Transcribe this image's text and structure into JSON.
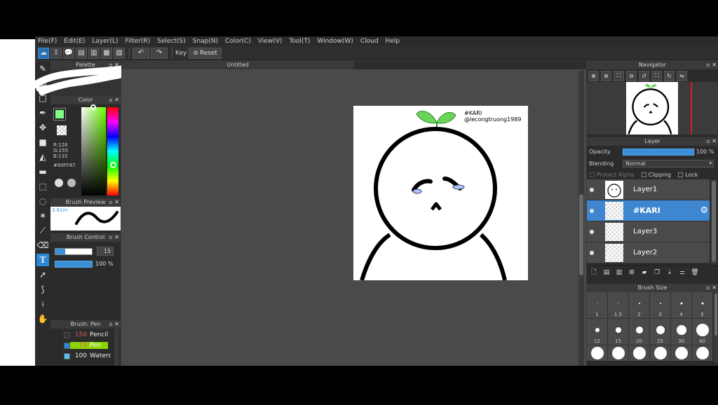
{
  "menu": [
    "File(F)",
    "Edit(E)",
    "Layer(L)",
    "Filter(R)",
    "Select(S)",
    "Snap(N)",
    "Color(C)",
    "View(V)",
    "Tool(T)",
    "Window(W)",
    "Cloud",
    "Help"
  ],
  "toolbar": {
    "key_label": "Key",
    "reset_label": "Reset"
  },
  "left": {
    "palette_title": "Palette",
    "color_title": "Color",
    "color_r": "R:128",
    "color_g": "G:255",
    "color_b": "B:135",
    "color_hex": "#80FF87",
    "primary_color": "#80FF87",
    "brush_preview_title": "Brush Preview",
    "brush_preview_size": "3.81m",
    "brush_control_title": "Brush Control",
    "brush_size_value": "15",
    "brush_opacity_value": "100 %",
    "brush_title": "Brush: Pen",
    "brushes": [
      {
        "size": "150",
        "name": "Pencil"
      },
      {
        "size": "15",
        "name": "Pen"
      },
      {
        "size": "100",
        "name": "Watercolor"
      }
    ]
  },
  "canvas": {
    "tab_title": "Untitled",
    "art_tag": "#KARI",
    "art_handle": "@lecongtruong1989"
  },
  "navigator": {
    "title": "Navigator"
  },
  "layer_panel": {
    "title": "Layer",
    "opacity_label": "Opacity",
    "opacity_value": "100 %",
    "opacity_fraction": 1.0,
    "blending_label": "Blending",
    "blending_value": "Normal",
    "protect_alpha": "Protect Alpha",
    "clipping": "Clipping",
    "lock": "Lock",
    "layers": [
      {
        "name": "Layer1",
        "selected": false
      },
      {
        "name": "#KARI",
        "selected": true
      },
      {
        "name": "Layer3",
        "selected": false
      },
      {
        "name": "Layer2",
        "selected": false
      }
    ]
  },
  "brush_size": {
    "title": "Brush Size",
    "sizes": [
      "1",
      "1.5",
      "2",
      "3",
      "4",
      "5",
      "12",
      "15",
      "20",
      "25",
      "30",
      "40"
    ]
  },
  "colors": {
    "accent": "#3f86d0",
    "selected_brush": "#8bd400"
  }
}
